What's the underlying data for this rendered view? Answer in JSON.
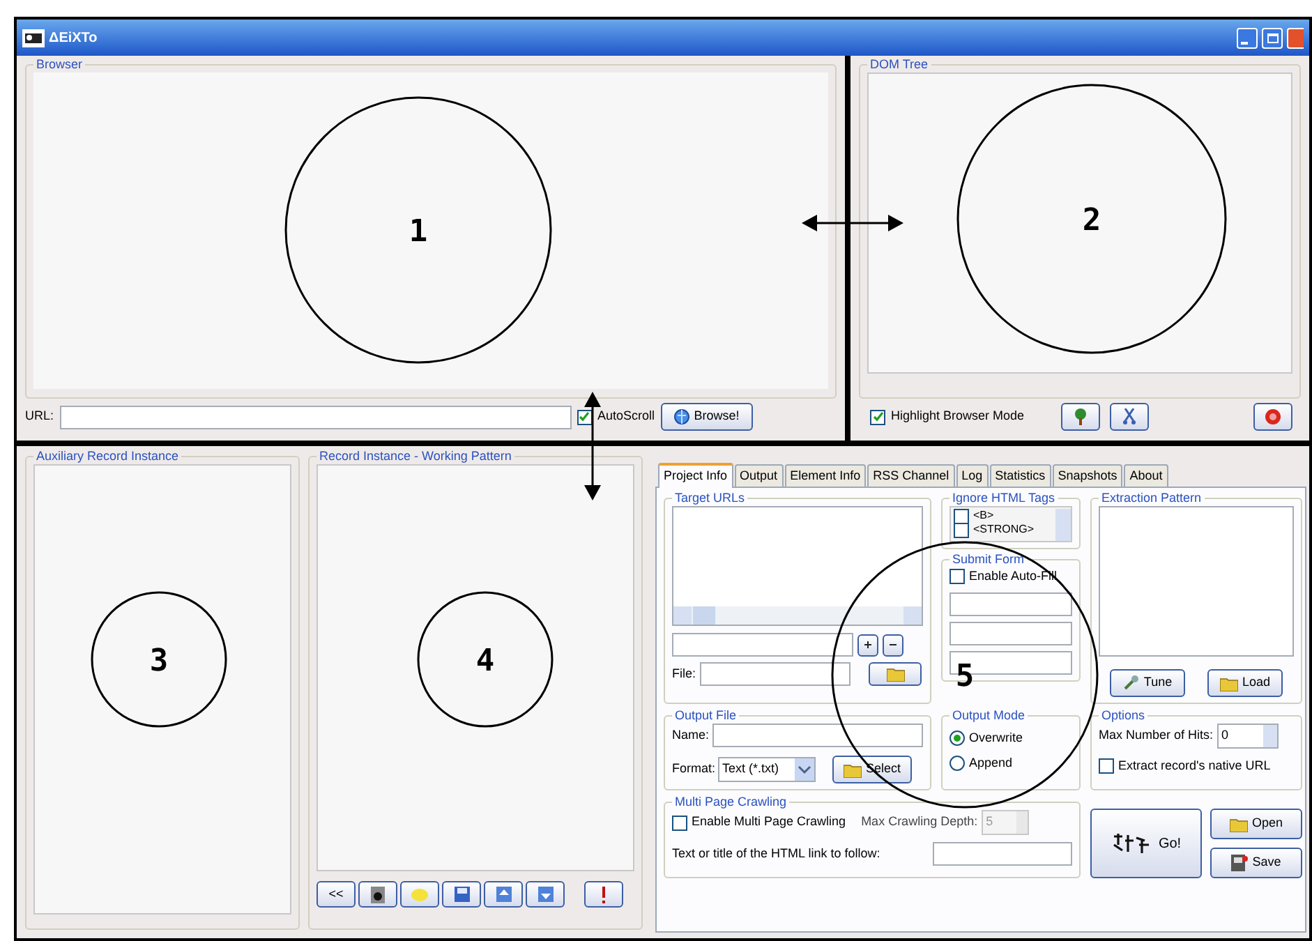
{
  "window": {
    "title": "ΔEiXTo"
  },
  "browser": {
    "title": "Browser",
    "url_label": "URL:",
    "autoscroll": {
      "label": "AutoScroll",
      "checked": true
    },
    "browse_button": "Browse!"
  },
  "dom_tree": {
    "title": "DOM Tree",
    "highlight": {
      "label": "Highlight Browser Mode",
      "checked": true
    }
  },
  "auxiliary": {
    "title": "Auxiliary Record Instance"
  },
  "record_instance": {
    "title": "Record Instance - Working Pattern",
    "back_button": "<<"
  },
  "tabs": [
    {
      "label": "Project Info",
      "selected": true
    },
    {
      "label": "Output",
      "selected": false
    },
    {
      "label": "Element Info",
      "selected": false
    },
    {
      "label": "RSS Channel",
      "selected": false
    },
    {
      "label": "Log",
      "selected": false
    },
    {
      "label": "Statistics",
      "selected": false
    },
    {
      "label": "Snapshots",
      "selected": false
    },
    {
      "label": "About",
      "selected": false
    }
  ],
  "target_urls": {
    "title": "Target URLs",
    "file_label": "File:"
  },
  "ignore_html_tags": {
    "title": "Ignore HTML Tags",
    "items": [
      {
        "label": "<B>",
        "checked": false
      },
      {
        "label": "<STRONG>",
        "checked": false
      }
    ]
  },
  "submit_form": {
    "title": "Submit Form",
    "auto_fill": {
      "label": "Enable Auto-Fill",
      "checked": false
    }
  },
  "extraction_pattern": {
    "title": "Extraction Pattern",
    "tune_button": "Tune",
    "load_button": "Load"
  },
  "output_file": {
    "title": "Output File",
    "name_label": "Name:",
    "format_label": "Format:",
    "format_value": "Text (*.txt)",
    "select_button": "Select"
  },
  "output_mode": {
    "title": "Output Mode",
    "options": [
      {
        "label": "Overwrite",
        "selected": true
      },
      {
        "label": "Append",
        "selected": false
      }
    ]
  },
  "options": {
    "title": "Options",
    "max_hits_label": "Max Number of Hits:",
    "max_hits_value": "0",
    "native_url": {
      "label": "Extract record's native URL",
      "checked": false
    }
  },
  "multi_page_crawling": {
    "title": "Multi Page Crawling",
    "enable": {
      "label": "Enable Multi Page Crawling",
      "checked": false
    },
    "depth_label": "Max Crawling Depth:",
    "depth_value": "5",
    "link_label": "Text or title of the HTML link to follow:"
  },
  "go_button": "Go!",
  "open_button": "Open",
  "save_button": "Save",
  "callouts": [
    {
      "label": "1"
    },
    {
      "label": "2"
    },
    {
      "label": "3"
    },
    {
      "label": "4"
    },
    {
      "label": "5"
    }
  ]
}
